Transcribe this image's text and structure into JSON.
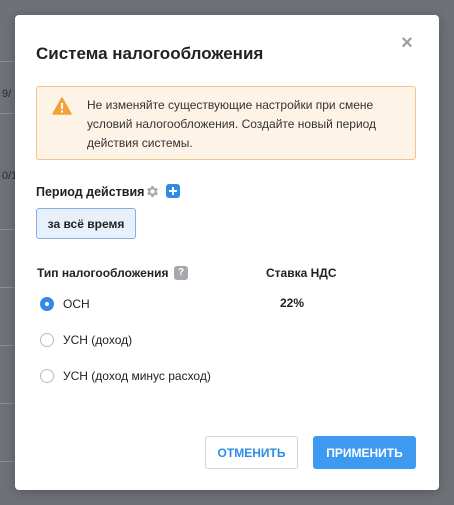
{
  "backdrop": {
    "fragments": [
      "9/",
      "0/1"
    ]
  },
  "modal": {
    "title": "Система налогообложения",
    "close_icon": "close-icon"
  },
  "warning": {
    "icon": "warning-icon",
    "text": "Не изменяйте существующие настройки при смене условий налогообложения. Создайте новый период действия системы."
  },
  "period": {
    "label": "Период действия",
    "settings_icon": "gear-icon",
    "add_icon": "plus-icon",
    "selected": "за всё время"
  },
  "tax": {
    "header": "Тип налогообложения",
    "help_icon": "question-icon",
    "help_glyph": "?",
    "vat_header": "Ставка НДС",
    "options": [
      {
        "label": "ОСН",
        "checked": true,
        "vat": "22%"
      },
      {
        "label": "УСН (доход)",
        "checked": false
      },
      {
        "label": "УСН (доход минус расход)",
        "checked": false
      }
    ]
  },
  "buttons": {
    "cancel": "ОТМЕНИТЬ",
    "apply": "ПРИМЕНИТЬ"
  },
  "colors": {
    "accent": "#2f8be6",
    "warning_bg": "#fdf3e7",
    "warning_border": "#f3c48b",
    "warning_icon": "#f5a13a"
  }
}
